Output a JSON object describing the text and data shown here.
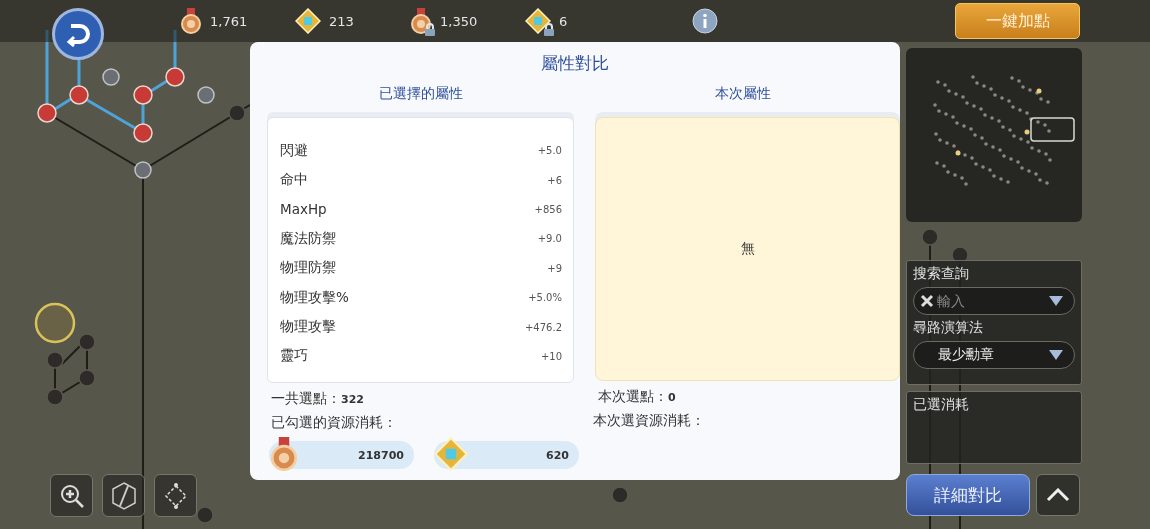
{
  "top_bar": {
    "resources": [
      {
        "kind": "medal",
        "amount": "1,761",
        "locked": false
      },
      {
        "kind": "gem",
        "amount": "213",
        "locked": false
      },
      {
        "kind": "medal",
        "amount": "1,350",
        "locked": true
      },
      {
        "kind": "gem",
        "amount": "6",
        "locked": true
      }
    ],
    "auto_assign_button": "一鍵加點"
  },
  "dialog": {
    "title": "屬性對比",
    "selected_panel": {
      "heading": "已選擇的屬性",
      "attributes": [
        {
          "name": "閃避",
          "value": "+5.0"
        },
        {
          "name": "命中",
          "value": "+6"
        },
        {
          "name": "MaxHp",
          "value": "+856"
        },
        {
          "name": "魔法防禦",
          "value": "+9.0"
        },
        {
          "name": "物理防禦",
          "value": "+9"
        },
        {
          "name": "物理攻擊%",
          "value": "+5.0%"
        },
        {
          "name": "物理攻擊",
          "value": "+476.2"
        },
        {
          "name": "靈巧",
          "value": "+10"
        }
      ],
      "points_label": "一共選點：",
      "points": "322",
      "cost_label": "已勾選的資源消耗：",
      "costs": [
        {
          "kind": "medal",
          "amount": "218700"
        },
        {
          "kind": "gem",
          "amount": "620"
        }
      ]
    },
    "current_panel": {
      "heading": "本次屬性",
      "empty_text": "無",
      "points_label": "本次選點：",
      "points": "0",
      "cost_label": "本次選資源消耗："
    }
  },
  "side_panel": {
    "search_label": "搜索查詢",
    "search_placeholder": "輸入",
    "algorithm_label": "尋路演算法",
    "algorithm_value": "最少勳章",
    "spent_label": "已選消耗",
    "compare_button": "詳細對比"
  }
}
